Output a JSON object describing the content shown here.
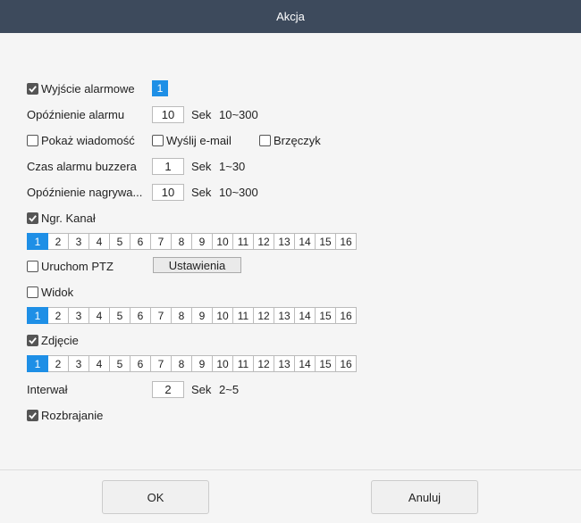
{
  "window": {
    "title": "Akcja"
  },
  "alarm_output": {
    "label": "Wyjście alarmowe",
    "checked": true,
    "value": "1"
  },
  "alarm_delay": {
    "label": "Opóźnienie alarmu",
    "value": "10",
    "unit": "Sek",
    "range": "10~300"
  },
  "options": [
    {
      "label": "Pokaż wiadomość",
      "checked": false
    },
    {
      "label": "Wyślij e-mail",
      "checked": false
    },
    {
      "label": "Brzęczyk",
      "checked": false
    }
  ],
  "buzzer_time": {
    "label": "Czas alarmu buzzera",
    "value": "1",
    "unit": "Sek",
    "range": "1~30"
  },
  "record_delay": {
    "label": "Opóźnienie nagrywa...",
    "value": "10",
    "unit": "Sek",
    "range": "10~300"
  },
  "record_channel": {
    "label": "Ngr. Kanał",
    "checked": true,
    "selected": "1"
  },
  "ptz": {
    "label": "Uruchom PTZ",
    "checked": false,
    "button": "Ustawienia"
  },
  "view": {
    "label": "Widok",
    "checked": false,
    "selected": "1"
  },
  "snapshot": {
    "label": "Zdjęcie",
    "checked": true,
    "selected": "1"
  },
  "interval": {
    "label": "Interwał",
    "value": "2",
    "unit": "Sek",
    "range": "2~5"
  },
  "disarm": {
    "label": "Rozbrajanie",
    "checked": true
  },
  "channels": [
    "1",
    "2",
    "3",
    "4",
    "5",
    "6",
    "7",
    "8",
    "9",
    "10",
    "11",
    "12",
    "13",
    "14",
    "15",
    "16"
  ],
  "footer": {
    "ok": "OK",
    "cancel": "Anuluj"
  },
  "colors": {
    "titlebar": "#3d4a5c",
    "accent": "#1e8fe6"
  }
}
